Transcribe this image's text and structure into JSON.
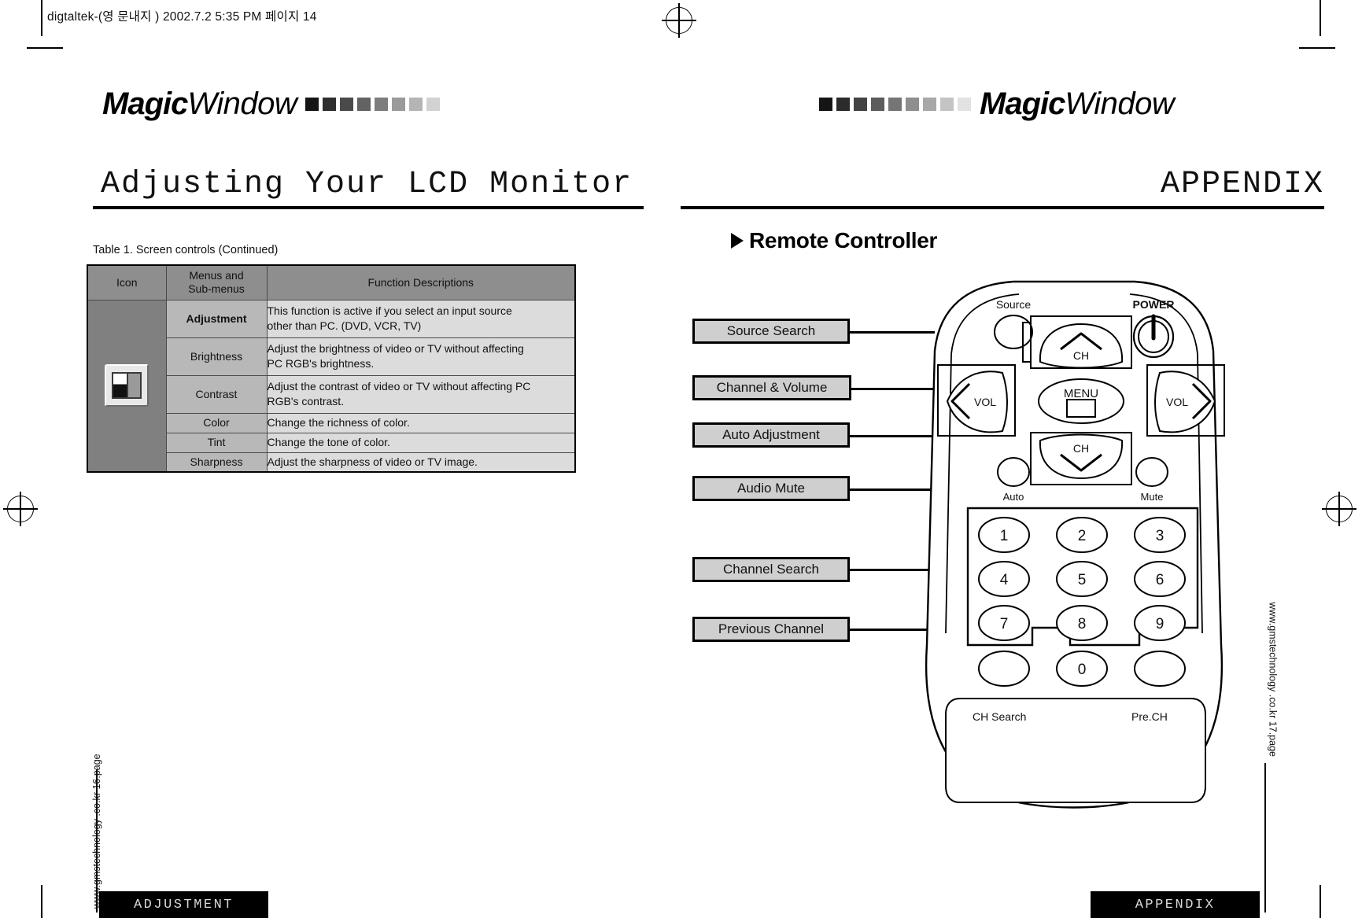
{
  "print_slug": "digtaltek-(영 문내지 )  2002.7.2 5:35 PM  페이지 14",
  "brand": {
    "name_bold": "Magic",
    "name_light": "Window",
    "swatch_colors_left": [
      "#151515",
      "#2f2f2f",
      "#4a4a4a",
      "#636363",
      "#7d7d7d",
      "#9a9a9a",
      "#b5b5b5",
      "#d2d2d2"
    ],
    "swatch_colors_right": [
      "#151515",
      "#2b2b2b",
      "#434343",
      "#5c5c5c",
      "#757575",
      "#8e8e8e",
      "#a8a8a8",
      "#c4c4c4",
      "#e2e2e2"
    ]
  },
  "left_page": {
    "title": "Adjusting Your LCD Monitor",
    "table_caption": "Table 1. Screen controls (Continued)",
    "table": {
      "headers": [
        "Icon",
        "Menus and\nSub-menus",
        "Function Descriptions"
      ],
      "header_icon": "Icon",
      "header_menus_line1": "Menus and",
      "header_menus_line2": "Sub-menus",
      "header_desc": "Function Descriptions",
      "icon_name": "adjustment-monitor-icon",
      "rows": [
        {
          "menu": "Adjustment",
          "bold": true,
          "desc_line1": "This function is active if you select an input source",
          "desc_line2": "other than PC. (DVD, VCR, TV)"
        },
        {
          "menu": "Brightness",
          "bold": false,
          "desc_line1": "Adjust the brightness of video or TV without affecting",
          "desc_line2": "PC RGB's brightness."
        },
        {
          "menu": "Contrast",
          "bold": false,
          "desc_line1": "Adjust the contrast of video or TV without affecting PC",
          "desc_line2": "RGB's contrast."
        },
        {
          "menu": "Color",
          "bold": false,
          "desc_line1": "Change the richness of color.",
          "desc_line2": ""
        },
        {
          "menu": "Tint",
          "bold": false,
          "desc_line1": "Change the tone of color.",
          "desc_line2": ""
        },
        {
          "menu": "Sharpness",
          "bold": false,
          "desc_line1": "Adjust the sharpness of video or TV image.",
          "desc_line2": ""
        }
      ]
    },
    "side_url": "www.gmstechnology .co.kr    16.page",
    "footer_tab": "ADJUSTMENT"
  },
  "right_page": {
    "title": "APPENDIX",
    "section_heading": "Remote Controller",
    "callouts": [
      "Source Search",
      "Channel & Volume",
      "Auto Adjustment",
      "Audio Mute",
      "Channel Search",
      "Previous Channel"
    ],
    "remote": {
      "label_source": "Source",
      "label_power": "POWER",
      "label_ch_up": "CH",
      "label_ch_down": "CH",
      "label_vol_left": "VOL",
      "label_vol_right": "VOL",
      "label_menu": "MENU",
      "label_auto": "Auto",
      "label_mute": "Mute",
      "keypad": [
        "1",
        "2",
        "3",
        "4",
        "5",
        "6",
        "7",
        "8",
        "9"
      ],
      "key_zero": "0",
      "label_ch_search": "CH Search",
      "label_pre_ch": "Pre.CH"
    },
    "side_url": "www.gmstechnology .co.kr    17.page",
    "footer_tab": "APPENDIX"
  }
}
